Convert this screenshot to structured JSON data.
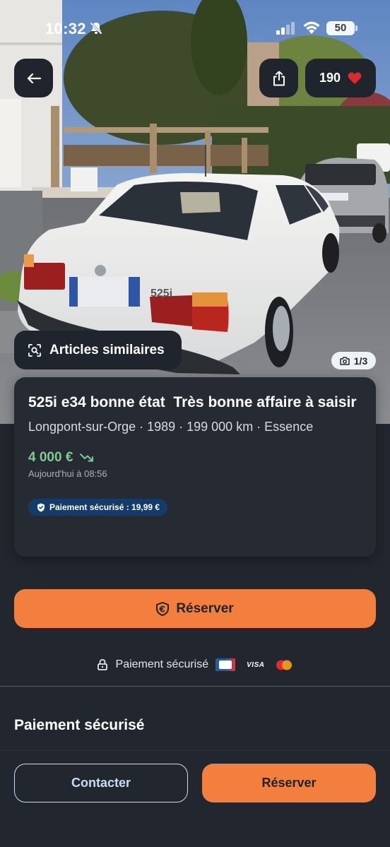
{
  "status_bar": {
    "time": "10:32",
    "battery": "50",
    "icons": [
      "bell-slash-icon",
      "signal-icon",
      "wifi-icon",
      "battery-icon"
    ]
  },
  "hero": {
    "favorites_count": "190",
    "similar_label": "Articles similaires",
    "photo_counter": "1/3",
    "icons": [
      "back-arrow-icon",
      "share-icon",
      "heart-icon",
      "image-search-icon",
      "camera-icon"
    ]
  },
  "listing": {
    "title": "525i e34 bonne état  Très bonne affaire à saisir",
    "meta": "Longpont-sur-Orge · 1989 · 199 000 km · Essence",
    "price": "4 000 €",
    "date": "Aujourd'hui à 08:56",
    "secure_badge": "Paiement sécurisé : 19,99 €",
    "price_trend_icon": "trending-down-icon"
  },
  "actions": {
    "reserve_label": "Réserver",
    "payment_text": "Paiement sécurisé",
    "payment_logos": [
      "cb",
      "visa",
      "mastercard"
    ],
    "visa_label": "VISA",
    "section_title": "Paiement sécurisé",
    "contact_label": "Contacter",
    "reserve_bottom_label": "Réserver"
  },
  "colors": {
    "background": "#22272f",
    "card": "#262b33",
    "accent": "#f27f3d",
    "price": "#7ecb8f",
    "secure_badge_bg": "#143c6b",
    "contact_border": "#c5ddf5",
    "heart": "#d92b2b"
  }
}
